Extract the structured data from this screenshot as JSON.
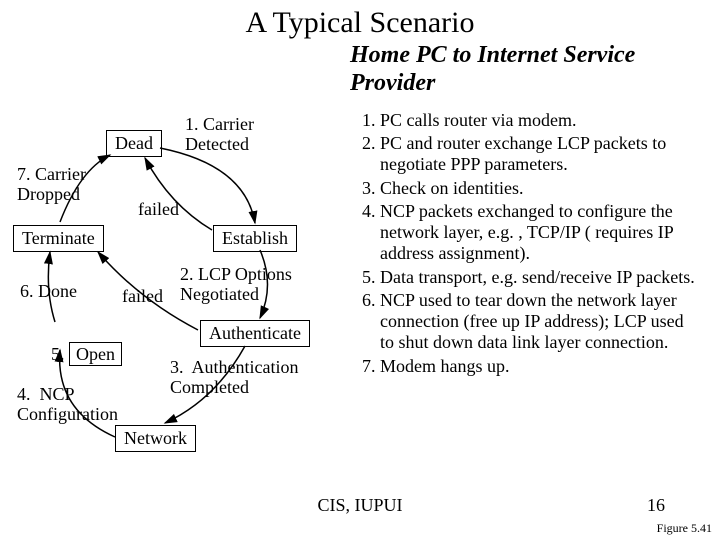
{
  "title": "A Typical Scenario",
  "subtitle": "Home PC to Internet Service Provider",
  "states": {
    "dead": "Dead",
    "establish": "Establish",
    "authenticate": "Authenticate",
    "network": "Network",
    "terminate": "Terminate",
    "open": "Open"
  },
  "edge_labels": {
    "e1": "1. Carrier\nDetected",
    "e2": "2. LCP Options\nNegotiated",
    "e3": "3.  Authentication\nCompleted",
    "e4": "4.  NCP\nConfiguration",
    "e5": "5.",
    "e6": "6. Done",
    "e7": "7. Carrier\nDropped",
    "failed1": "failed",
    "failed2": "failed"
  },
  "steps": [
    "PC calls router via modem.",
    "PC and router exchange LCP packets to negotiate PPP parameters.",
    "Check on identities.",
    "NCP packets exchanged to configure the network layer, e.g. , TCP/IP ( requires IP address assignment).",
    "Data transport, e.g. send/receive IP packets.",
    "NCP used to tear down the network layer connection (free up IP address); LCP used to shut down data link layer connection.",
    "Modem hangs up."
  ],
  "footer": "CIS, IUPUI",
  "page_number": "16",
  "figure_ref": "Figure 5.41"
}
